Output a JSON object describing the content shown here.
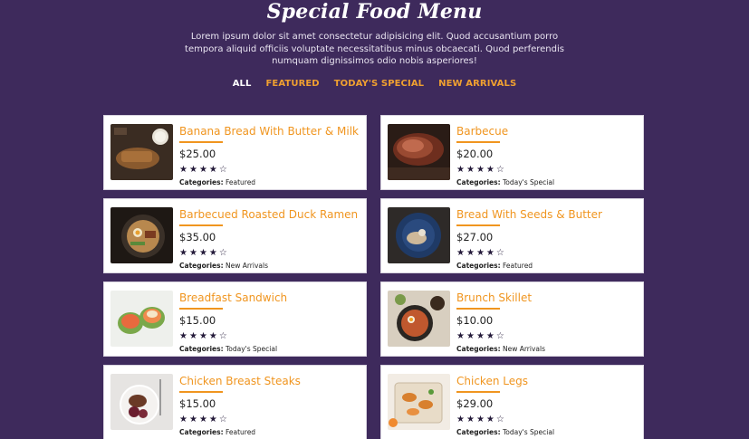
{
  "header": {
    "title": "Special Food Menu",
    "intro": "Lorem ipsum dolor sit amet consectetur adipisicing elit. Quod accusantium porro tempora aliquid officiis voluptate necessitatibus minus obcaecati. Quod perferendis numquam dignissimos odio nobis asperiores!"
  },
  "filters": [
    {
      "label": "ALL",
      "active": true
    },
    {
      "label": "FEATURED",
      "active": false
    },
    {
      "label": "TODAY'S SPECIAL",
      "active": false
    },
    {
      "label": "NEW ARRIVALS",
      "active": false
    }
  ],
  "category_label": "Categories:",
  "colors": {
    "background": "#3e2a5c",
    "accent": "#f0951f",
    "star": "#241a3a"
  },
  "items": [
    {
      "name": "Banana Bread With Butter & Milk",
      "price": "$25.00",
      "rating": 4,
      "category": "Featured",
      "icon": "banana-bread-photo"
    },
    {
      "name": "Barbecue",
      "price": "$20.00",
      "rating": 4,
      "category": "Today's Special",
      "icon": "barbecue-photo"
    },
    {
      "name": "Barbecued Roasted Duck Ramen",
      "price": "$35.00",
      "rating": 4,
      "category": "New Arrivals",
      "icon": "duck-ramen-photo"
    },
    {
      "name": "Bread With Seeds & Butter",
      "price": "$27.00",
      "rating": 4,
      "category": "Featured",
      "icon": "seed-bread-photo"
    },
    {
      "name": "Breadfast Sandwich",
      "price": "$15.00",
      "rating": 4,
      "category": "Today's Special",
      "icon": "sandwich-photo"
    },
    {
      "name": "Brunch Skillet",
      "price": "$10.00",
      "rating": 4,
      "category": "New Arrivals",
      "icon": "skillet-photo"
    },
    {
      "name": "Chicken Breast Steaks",
      "price": "$15.00",
      "rating": 4,
      "category": "Featured",
      "icon": "chicken-steak-photo"
    },
    {
      "name": "Chicken Legs",
      "price": "$29.00",
      "rating": 4,
      "category": "Today's Special",
      "icon": "chicken-legs-photo"
    }
  ]
}
